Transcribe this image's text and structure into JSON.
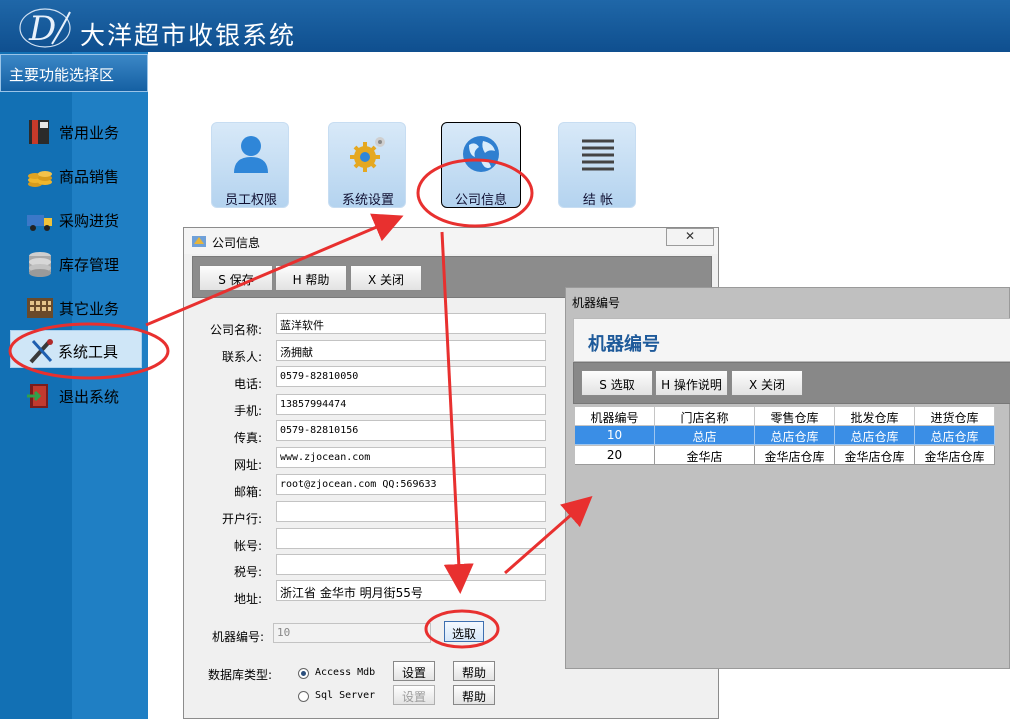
{
  "app": {
    "title": "大洋超市收银系统",
    "logo_letter": "D"
  },
  "sidebar": {
    "heading": "主要功能选择区",
    "items": [
      {
        "label": "常用业务",
        "icon": "book-icon"
      },
      {
        "label": "商品销售",
        "icon": "coins-icon"
      },
      {
        "label": "采购进货",
        "icon": "truck-icon"
      },
      {
        "label": "库存管理",
        "icon": "database-icon"
      },
      {
        "label": "其它业务",
        "icon": "calculator-icon"
      },
      {
        "label": "系统工具",
        "icon": "tools-icon"
      },
      {
        "label": "退出系统",
        "icon": "exit-door-icon"
      }
    ],
    "active_item": "系统工具"
  },
  "toolbar_buttons": [
    {
      "label": "员工权限",
      "icon": "user-icon"
    },
    {
      "label": "系统设置",
      "icon": "gear-icon"
    },
    {
      "label": "公司信息",
      "icon": "globe-icon"
    },
    {
      "label": "结 帐",
      "icon": "ledger-lines-icon"
    }
  ],
  "company_window": {
    "title": "公司信息",
    "close_glyph": "✕",
    "toolbar": {
      "save": "S 保存",
      "help": "H 帮助",
      "close": "X 关闭"
    },
    "fields": [
      {
        "label": "公司名称:",
        "value": "蓝洋软件"
      },
      {
        "label": "联系人:",
        "value": "汤拥献"
      },
      {
        "label": "电话:",
        "value": "0579-82810050"
      },
      {
        "label": "手机:",
        "value": "13857994474"
      },
      {
        "label": "传真:",
        "value": "0579-82810156"
      },
      {
        "label": "网址:",
        "value": "www.zjocean.com"
      },
      {
        "label": "邮箱:",
        "value": "root@zjocean.com  QQ:569633"
      },
      {
        "label": "开户行:",
        "value": ""
      },
      {
        "label": "帐号:",
        "value": ""
      },
      {
        "label": "税号:",
        "value": ""
      },
      {
        "label": "地址:",
        "value": "浙江省 金华市 明月街55号"
      }
    ],
    "machine": {
      "label": "机器编号:",
      "value": "10",
      "pick_button": "选取"
    },
    "database": {
      "label": "数据库类型:",
      "options": [
        {
          "label": "Access Mdb",
          "checked": true,
          "setup": "设置",
          "help": "帮助"
        },
        {
          "label": "Sql Server",
          "checked": false,
          "setup": "设置",
          "help": "帮助"
        }
      ]
    }
  },
  "machine_window": {
    "title": "机器编号",
    "heading": "机器编号",
    "toolbar": {
      "select": "S 选取",
      "manual": "H 操作说明",
      "close": "X 关闭"
    },
    "columns": [
      "机器编号",
      "门店名称",
      "零售仓库",
      "批发仓库",
      "进货仓库"
    ],
    "rows": [
      [
        "10",
        "总店",
        "总店仓库",
        "总店仓库",
        "总店仓库"
      ],
      [
        "20",
        "金华店",
        "金华店仓库",
        "金华店仓库",
        "金华店仓库"
      ]
    ],
    "selected_row": 0
  },
  "colors": {
    "header": "#1a5f9f",
    "sidebar": "#1f7fc4",
    "annotation": "#e8302f",
    "selected_row": "#3a8ee6"
  }
}
